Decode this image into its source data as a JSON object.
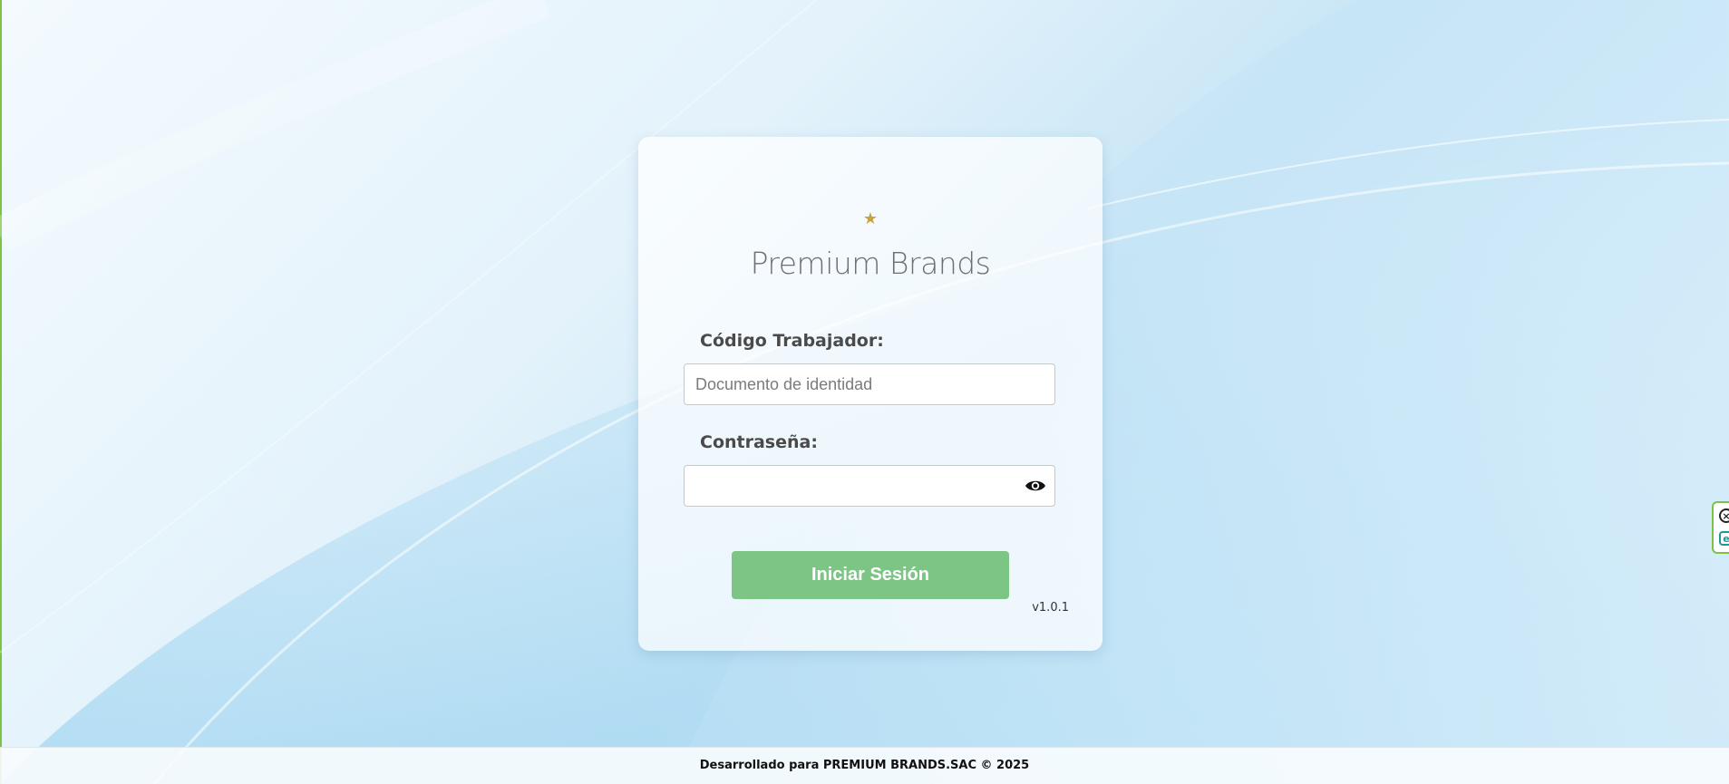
{
  "brand": {
    "star_glyph": "★",
    "name": "Premium Brands",
    "star_color": "#c9a23d"
  },
  "form": {
    "user_label": "Código Trabajador:",
    "user_placeholder": "Documento de identidad",
    "user_value": "",
    "password_label": "Contraseña:",
    "password_value": "",
    "show_password_icon": "eye-icon",
    "submit_label": "Iniciar Sesión",
    "submit_color": "#7dc584"
  },
  "version": "v1.0.1",
  "footer": {
    "text": "Desarrollado para PREMIUM BRANDS.SAC © 2025"
  },
  "side_widget": {
    "close_icon": "close-icon",
    "edit_icon": "edit-icon",
    "accent_color": "#7cc243"
  }
}
